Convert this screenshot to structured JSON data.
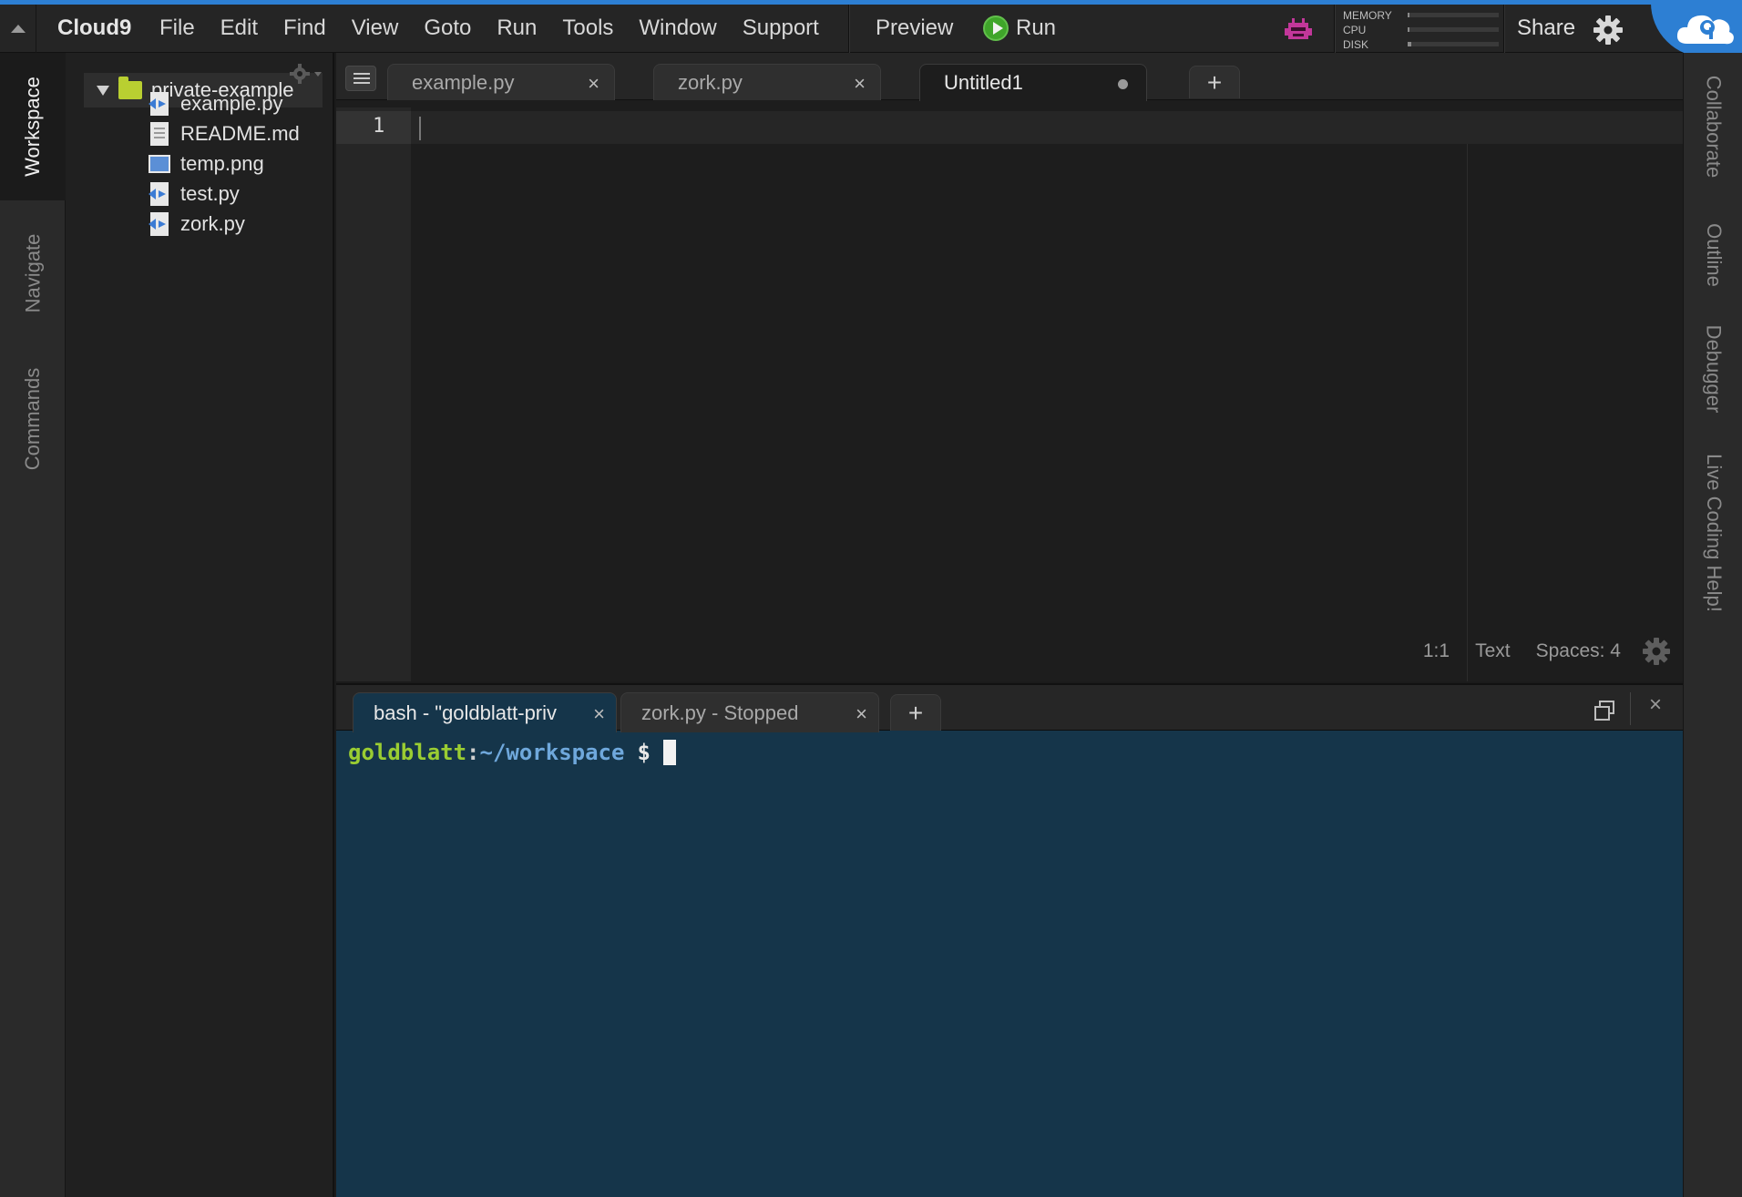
{
  "menubar": {
    "brand": "Cloud9",
    "menus": [
      "File",
      "Edit",
      "Find",
      "View",
      "Goto",
      "Run",
      "Tools",
      "Window",
      "Support"
    ],
    "preview_label": "Preview",
    "run_label": "Run",
    "stats": {
      "memory_label": "MEMORY",
      "cpu_label": "CPU",
      "disk_label": "DISK",
      "memory_level": 0.02,
      "cpu_level": 0.02,
      "disk_level": 0.04
    },
    "share_label": "Share",
    "accent_color": "#2d7fd3"
  },
  "left_tabs": [
    "Workspace",
    "Navigate",
    "Commands"
  ],
  "tree": {
    "root": "private-example",
    "items": [
      {
        "name": "example.py",
        "icon": "python-file-icon"
      },
      {
        "name": "README.md",
        "icon": "text-file-icon"
      },
      {
        "name": "temp.png",
        "icon": "image-file-icon"
      },
      {
        "name": "test.py",
        "icon": "python-file-icon"
      },
      {
        "name": "zork.py",
        "icon": "python-file-icon"
      }
    ]
  },
  "editor": {
    "tabs": [
      {
        "label": "example.py",
        "close": "×"
      },
      {
        "label": "zork.py",
        "close": "×"
      },
      {
        "label": "Untitled1"
      }
    ],
    "add_tab": "+",
    "line_numbers": [
      "1"
    ],
    "status": {
      "position": "1:1",
      "mode": "Text",
      "indent": "Spaces: 4"
    }
  },
  "terminal": {
    "tabs": [
      {
        "label": "bash - \"goldblatt-priv",
        "close": "×"
      },
      {
        "label": "zork.py - Stopped",
        "close": "×"
      }
    ],
    "add_tab": "+",
    "close": "×",
    "prompt": {
      "user": "goldblatt",
      "colon": ":",
      "path": "~/workspace",
      "symbol": "$"
    }
  },
  "right_tabs": [
    "Collaborate",
    "Outline",
    "Debugger",
    "Live Coding Help!"
  ]
}
